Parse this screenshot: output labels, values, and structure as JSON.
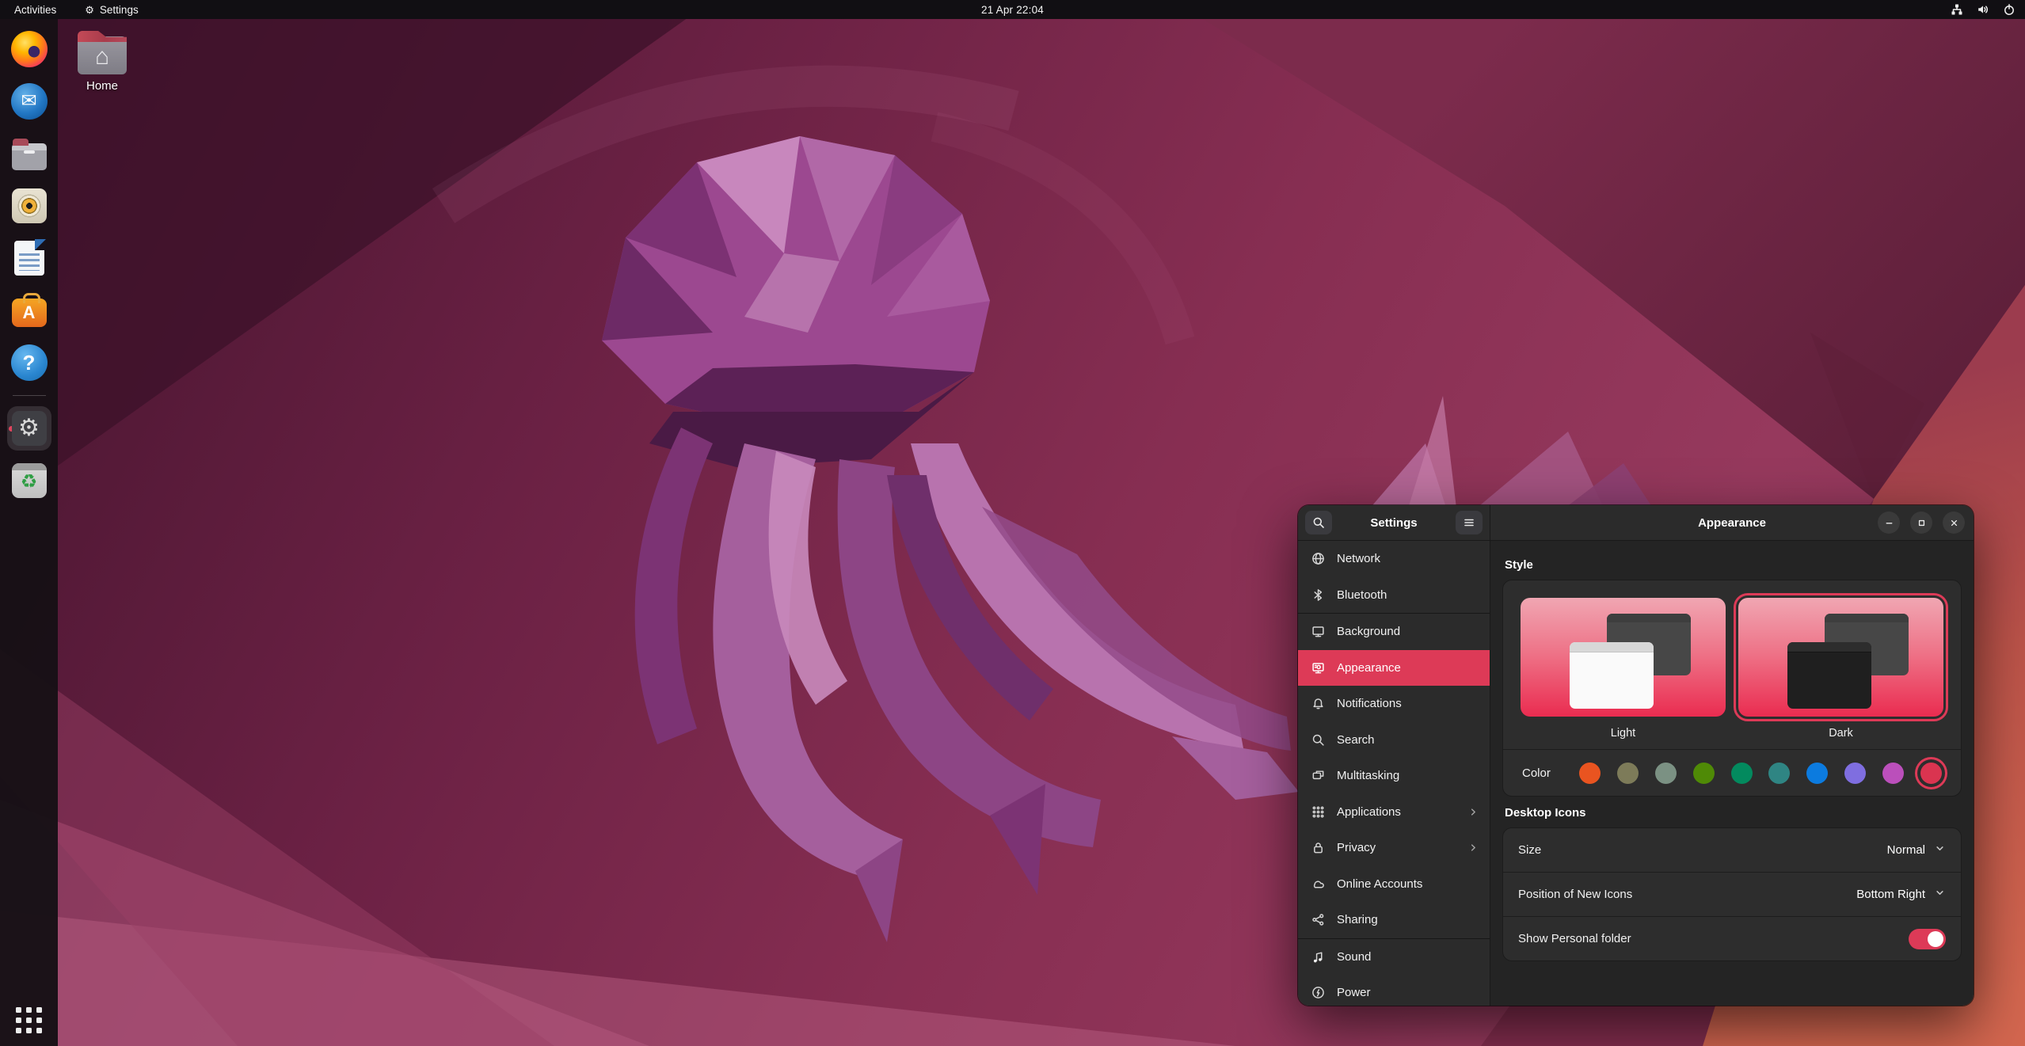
{
  "accent": "#dd3a57",
  "topbar": {
    "activities_label": "Activities",
    "app_menu_label": "Settings",
    "clock": "21 Apr 22:04",
    "tray_icons": [
      "wired-network-icon",
      "volume-icon",
      "power-icon"
    ]
  },
  "dock": {
    "items": [
      {
        "app": "firefox",
        "icon": "firefox-icon",
        "active": false
      },
      {
        "app": "thunderbird",
        "icon": "thunderbird-icon",
        "active": false
      },
      {
        "app": "files",
        "icon": "files-icon",
        "active": false
      },
      {
        "app": "rhythmbox",
        "icon": "rhythmbox-icon",
        "active": false
      },
      {
        "app": "libreoffice-writer",
        "icon": "writer-icon",
        "active": false
      },
      {
        "app": "ubuntu-software",
        "icon": "software-icon",
        "active": false
      },
      {
        "app": "help",
        "icon": "help-icon",
        "active": false,
        "separator_after": true
      },
      {
        "app": "settings",
        "icon": "settings-icon",
        "active": true
      },
      {
        "app": "software-updater",
        "icon": "updater-icon",
        "active": false
      }
    ]
  },
  "desktop": {
    "home_label": "Home"
  },
  "settings_window": {
    "sidebar": {
      "title": "Settings",
      "items": [
        {
          "label": "Network",
          "icon": "globe"
        },
        {
          "label": "Bluetooth",
          "icon": "bluetooth"
        },
        {
          "label": "Background",
          "icon": "display",
          "group_start": true
        },
        {
          "label": "Appearance",
          "icon": "appearance",
          "selected": true
        },
        {
          "label": "Notifications",
          "icon": "bell"
        },
        {
          "label": "Search",
          "icon": "search"
        },
        {
          "label": "Multitasking",
          "icon": "multitask"
        },
        {
          "label": "Applications",
          "icon": "grid",
          "chevron": true
        },
        {
          "label": "Privacy",
          "icon": "lock",
          "chevron": true
        },
        {
          "label": "Online Accounts",
          "icon": "cloud"
        },
        {
          "label": "Sharing",
          "icon": "share"
        },
        {
          "label": "Sound",
          "icon": "note",
          "group_start": true
        },
        {
          "label": "Power",
          "icon": "power"
        }
      ]
    },
    "header": {
      "title": "Appearance"
    },
    "style": {
      "heading": "Style",
      "options": [
        {
          "id": "light",
          "label": "Light",
          "selected": false
        },
        {
          "id": "dark",
          "label": "Dark",
          "selected": true
        }
      ],
      "color_label": "Color",
      "colors": [
        {
          "name": "orange",
          "hex": "#E95420"
        },
        {
          "name": "bark",
          "hex": "#7d7b59"
        },
        {
          "name": "sage",
          "hex": "#7b9183"
        },
        {
          "name": "olive",
          "hex": "#4f8a06"
        },
        {
          "name": "viridian",
          "hex": "#038a5e"
        },
        {
          "name": "prussian-green",
          "hex": "#2f8583"
        },
        {
          "name": "blue",
          "hex": "#0c7bdf"
        },
        {
          "name": "purple",
          "hex": "#7f6ee0"
        },
        {
          "name": "magenta",
          "hex": "#bb4fbb"
        },
        {
          "name": "red",
          "hex": "#da3450",
          "selected": true
        }
      ]
    },
    "desktop_icons": {
      "heading": "Desktop Icons",
      "rows": [
        {
          "label": "Size",
          "control": "dropdown",
          "value": "Normal"
        },
        {
          "label": "Position of New Icons",
          "control": "dropdown",
          "value": "Bottom Right"
        },
        {
          "label": "Show Personal folder",
          "control": "toggle",
          "on": true
        }
      ]
    }
  }
}
